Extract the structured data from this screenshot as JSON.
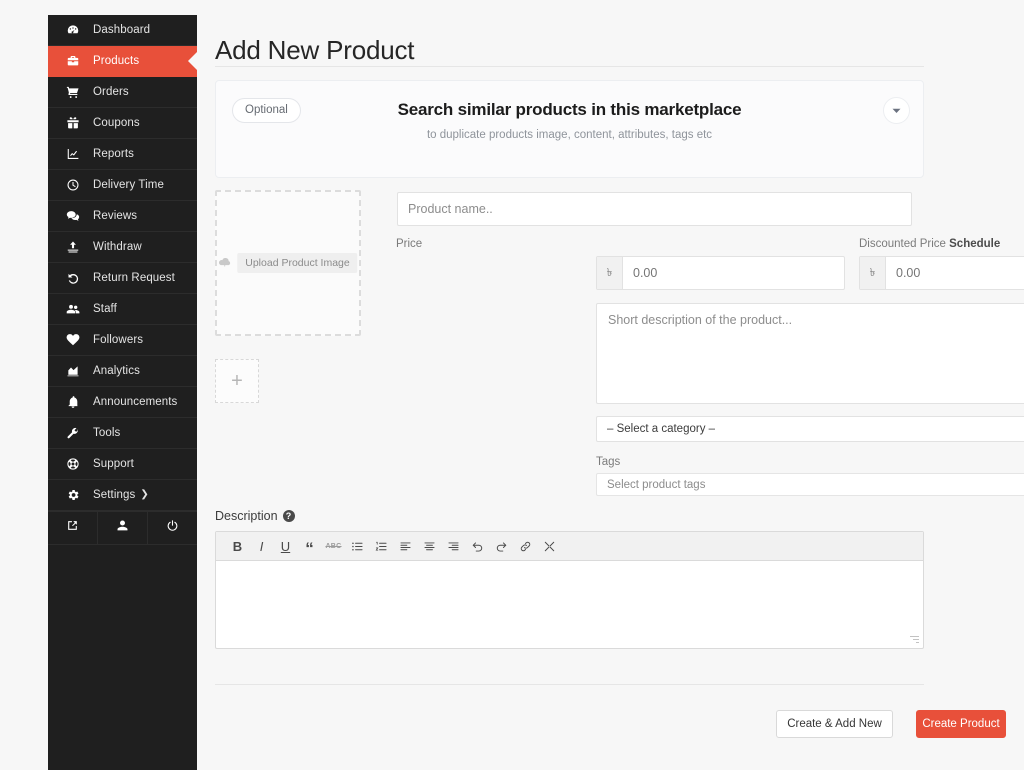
{
  "sidebar": {
    "items": [
      {
        "label": "Dashboard",
        "icon": "dashboard-gauge-icon",
        "active": false
      },
      {
        "label": "Products",
        "icon": "briefcase-icon",
        "active": true
      },
      {
        "label": "Orders",
        "icon": "shopping-cart-icon",
        "active": false
      },
      {
        "label": "Coupons",
        "icon": "gift-icon",
        "active": false
      },
      {
        "label": "Reports",
        "icon": "chart-line-icon",
        "active": false
      },
      {
        "label": "Delivery Time",
        "icon": "clock-icon",
        "active": false
      },
      {
        "label": "Reviews",
        "icon": "comments-icon",
        "active": false
      },
      {
        "label": "Withdraw",
        "icon": "upload-arrow-icon",
        "active": false
      },
      {
        "label": "Return Request",
        "icon": "undo-arrow-icon",
        "active": false
      },
      {
        "label": "Staff",
        "icon": "users-icon",
        "active": false
      },
      {
        "label": "Followers",
        "icon": "heart-icon",
        "active": false
      },
      {
        "label": "Analytics",
        "icon": "chart-area-icon",
        "active": false
      },
      {
        "label": "Announcements",
        "icon": "bell-icon",
        "active": false
      },
      {
        "label": "Tools",
        "icon": "wrench-icon",
        "active": false
      },
      {
        "label": "Support",
        "icon": "life-ring-icon",
        "active": false
      },
      {
        "label": "Settings",
        "icon": "gear-icon",
        "active": false,
        "caret": "❯"
      }
    ],
    "footer_buttons": [
      {
        "name": "visit-store-button",
        "icon": "external-link-icon"
      },
      {
        "name": "profile-button",
        "icon": "user-icon"
      },
      {
        "name": "logout-button",
        "icon": "power-icon"
      }
    ],
    "active_color": "#e8503a",
    "background_color": "#1f1f1f"
  },
  "header": {
    "title": "Add New Product"
  },
  "similar_card": {
    "badge": "Optional",
    "heading": "Search similar products in this marketplace",
    "subheading": "to duplicate products image, content, attributes, tags etc",
    "toggle_icon": "chevron-down-icon"
  },
  "image_upload": {
    "label": "Upload Product Image",
    "icon": "cloud-upload-icon",
    "add_more_label": "+"
  },
  "form": {
    "product_name": {
      "value": "",
      "placeholder": "Product name.."
    },
    "price": {
      "label": "Price",
      "currency_symbol": "৳",
      "value": "",
      "placeholder": "0.00"
    },
    "discounted_price": {
      "label": "Discounted Price",
      "link_label": "Schedule",
      "currency_symbol": "৳",
      "value": "",
      "placeholder": "0.00"
    },
    "short_description": {
      "value": "",
      "placeholder": "Short description of the product..."
    },
    "category": {
      "selected": "– Select a category –",
      "caret_icon": "chevron-down-icon"
    },
    "tags": {
      "label": "Tags",
      "value": "",
      "placeholder": "Select product tags"
    }
  },
  "description": {
    "label": "Description",
    "help_icon": "question-mark-icon",
    "help_glyph": "?",
    "body_text": "",
    "toolbar": [
      {
        "name": "bold-button",
        "glyph": "B",
        "style": "bold"
      },
      {
        "name": "italic-button",
        "glyph": "I",
        "style": "italic"
      },
      {
        "name": "underline-button",
        "glyph": "U",
        "style": "underline"
      },
      {
        "name": "blockquote-button",
        "glyph": "“",
        "style": "quote"
      },
      {
        "name": "strikethrough-button",
        "glyph": "ABC",
        "style": "strike"
      },
      {
        "name": "unordered-list-button",
        "glyph": "list-ul",
        "style": "icon"
      },
      {
        "name": "ordered-list-button",
        "glyph": "list-ol",
        "style": "icon"
      },
      {
        "name": "align-left-button",
        "glyph": "align-left",
        "style": "icon"
      },
      {
        "name": "align-center-button",
        "glyph": "align-center",
        "style": "icon"
      },
      {
        "name": "align-right-button",
        "glyph": "align-right",
        "style": "icon"
      },
      {
        "name": "undo-button",
        "glyph": "undo",
        "style": "icon"
      },
      {
        "name": "redo-button",
        "glyph": "redo",
        "style": "icon"
      },
      {
        "name": "link-button",
        "glyph": "link",
        "style": "icon"
      },
      {
        "name": "fullscreen-button",
        "glyph": "expand",
        "style": "icon"
      }
    ]
  },
  "actions": {
    "create_add_new": "Create & Add New",
    "create_product": "Create Product",
    "primary_color": "#e8503a"
  }
}
